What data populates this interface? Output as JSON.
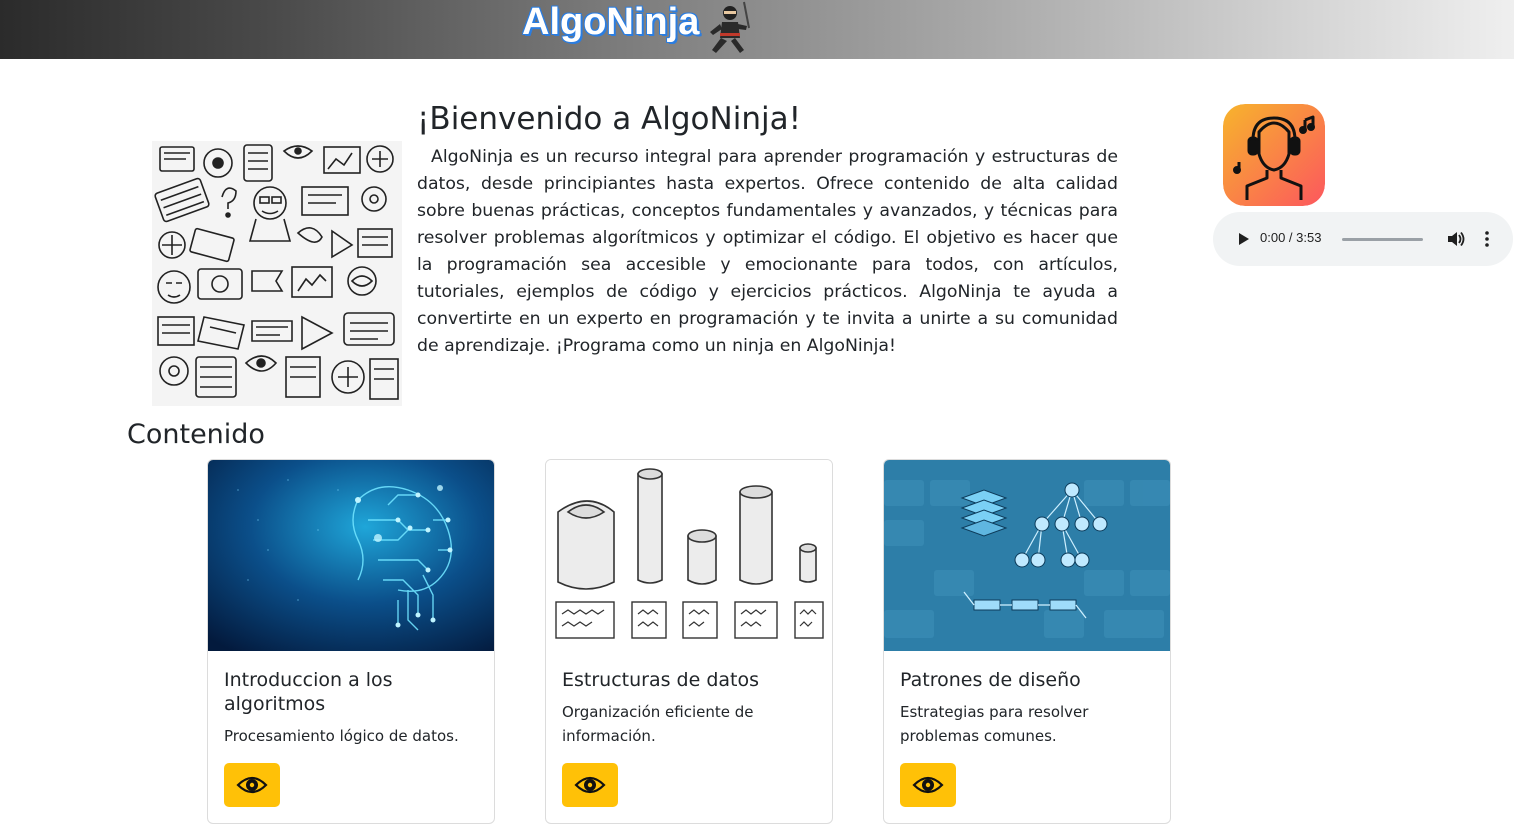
{
  "header": {
    "brand": "AlgoNinja",
    "gradient_colors": [
      "#2b2b2b",
      "#efefef"
    ],
    "logo_icon": "ninja-icon"
  },
  "hero": {
    "title": "¡Bienvenido a AlgoNinja!",
    "description": "AlgoNinja es un recurso integral para aprender programación y estructuras de datos, desde principiantes hasta expertos. Ofrece contenido de alta calidad sobre buenas prácticas, conceptos fundamentales y avanzados, y técnicas para resolver problemas algorítmicos y optimizar el código. El objetivo es hacer que la programación sea accesible y emocionante para todos, con artículos, tutoriales, ejemplos de código y ejercicios prácticos. AlgoNinja te ayuda a convertirte en un experto en programación y te invita a unirte a su comunidad de aprendizaje. ¡Programa como un ninja en AlgoNinja!",
    "image": "doodle-collage-image"
  },
  "audio": {
    "cover_icon": "headphones-person-icon",
    "time": "0:00 / 3:53",
    "progress": 0,
    "cover_gradient": [
      "#f7b42c",
      "#fc575e"
    ]
  },
  "section": {
    "title": "Contenido"
  },
  "cards": [
    {
      "title": "Introduccion a los algoritmos",
      "text": "Procesamiento lógico de datos.",
      "image": "circuit-brain-image",
      "button_icon": "eye-icon"
    },
    {
      "title": "Estructuras de datos",
      "text": "Organización eficiente de información.",
      "image": "paper-scrolls-image",
      "button_icon": "eye-icon"
    },
    {
      "title": "Patrones de diseño",
      "text": "Estrategias para resolver problemas comunes.",
      "image": "data-structures-keyboard-image",
      "button_icon": "eye-icon"
    }
  ],
  "colors": {
    "button": "#ffc107",
    "brand_outline": "#2b7de0"
  }
}
